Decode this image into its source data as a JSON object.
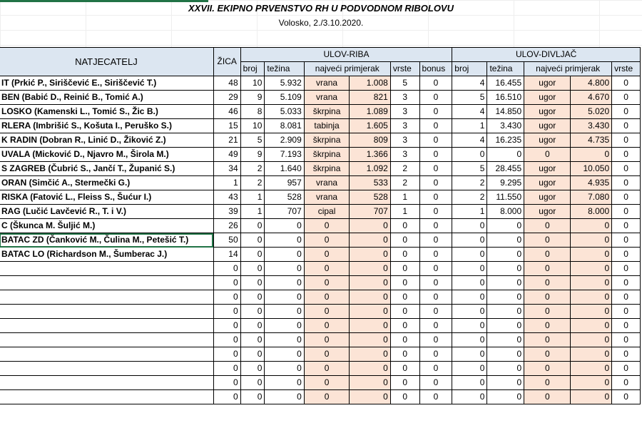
{
  "title": "XXVII. EKIPNO PRVENSTVO RH U PODVODNOM RIBOLOVU",
  "subtitle": "Volosko, 2./3.10.2020.",
  "headers": {
    "natjecatelj": "NATJECATELJ",
    "zica": "ŽICA",
    "ulov_riba": "ULOV-RIBA",
    "ulov_divljac": "ULOV-DIVLJAČ",
    "broj": "broj",
    "tezina": "težina",
    "najveci": "najveći primjerak",
    "vrste": "vrste",
    "bonus": "bonus"
  },
  "rows": [
    {
      "name": "IT (Prkić P., Siriščević E., Siriščević T.)",
      "zica": "48",
      "r_broj": "10",
      "r_tez": "5.932",
      "r_vrsta": "vrana",
      "r_naj": "1.008",
      "r_vrste": "5",
      "r_bonus": "0",
      "d_broj": "4",
      "d_tez": "16.455",
      "d_vrsta": "ugor",
      "d_naj": "4.800",
      "d_vrste": "0"
    },
    {
      "name": "BEN (Babić D., Reinić B., Tomić A.)",
      "zica": "29",
      "r_broj": "9",
      "r_tez": "5.109",
      "r_vrsta": "vrana",
      "r_naj": "821",
      "r_vrste": "3",
      "r_bonus": "0",
      "d_broj": "5",
      "d_tez": "16.510",
      "d_vrsta": "ugor",
      "d_naj": "4.670",
      "d_vrste": "0"
    },
    {
      "name": "LOSKO (Kamenski L., Tomić S., Žic B.)",
      "zica": "46",
      "r_broj": "8",
      "r_tez": "5.033",
      "r_vrsta": "škrpina",
      "r_naj": "1.089",
      "r_vrste": "3",
      "r_bonus": "0",
      "d_broj": "4",
      "d_tez": "14.850",
      "d_vrsta": "ugor",
      "d_naj": "5.020",
      "d_vrste": "0"
    },
    {
      "name": "RLERA (Imbrišić S., Košuta I., Peruško S.)",
      "zica": "15",
      "r_broj": "10",
      "r_tez": "8.081",
      "r_vrsta": "tabinja",
      "r_naj": "1.605",
      "r_vrste": "3",
      "r_bonus": "0",
      "d_broj": "1",
      "d_tez": "3.430",
      "d_vrsta": "ugor",
      "d_naj": "3.430",
      "d_vrste": "0"
    },
    {
      "name": "K RADIN (Dobran R., Linić D., Žiković Z.)",
      "zica": "21",
      "r_broj": "5",
      "r_tez": "2.909",
      "r_vrsta": "škrpina",
      "r_naj": "809",
      "r_vrste": "3",
      "r_bonus": "0",
      "d_broj": "4",
      "d_tez": "16.235",
      "d_vrsta": "ugor",
      "d_naj": "4.735",
      "d_vrste": "0"
    },
    {
      "name": "UVALA (Micković D., Njavro M., Širola M.)",
      "zica": "49",
      "r_broj": "9",
      "r_tez": "7.193",
      "r_vrsta": "škrpina",
      "r_naj": "1.366",
      "r_vrste": "3",
      "r_bonus": "0",
      "d_broj": "0",
      "d_tez": "0",
      "d_vrsta": "0",
      "d_naj": "0",
      "d_vrste": "0"
    },
    {
      "name": "S ZAGREB (Čubrić S., Jančí T., Županić S.)",
      "zica": "34",
      "r_broj": "2",
      "r_tez": "1.640",
      "r_vrsta": "škrpina",
      "r_naj": "1.092",
      "r_vrste": "2",
      "r_bonus": "0",
      "d_broj": "5",
      "d_tez": "28.455",
      "d_vrsta": "ugor",
      "d_naj": "10.050",
      "d_vrste": "0"
    },
    {
      "name": "ORAN (Simčić A., Stermečki G.)",
      "zica": "1",
      "r_broj": "2",
      "r_tez": "957",
      "r_vrsta": "vrana",
      "r_naj": "533",
      "r_vrste": "2",
      "r_bonus": "0",
      "d_broj": "2",
      "d_tez": "9.295",
      "d_vrsta": "ugor",
      "d_naj": "4.935",
      "d_vrste": "0"
    },
    {
      "name": "RISKA (Fatović L., Fleiss S., Šućur I.)",
      "zica": "43",
      "r_broj": "1",
      "r_tez": "528",
      "r_vrsta": "vrana",
      "r_naj": "528",
      "r_vrste": "1",
      "r_bonus": "0",
      "d_broj": "2",
      "d_tez": "11.550",
      "d_vrsta": "ugor",
      "d_naj": "7.080",
      "d_vrste": "0"
    },
    {
      "name": "RAG (Lučić Lavčević R., T. i V.)",
      "zica": "39",
      "r_broj": "1",
      "r_tez": "707",
      "r_vrsta": "cipal",
      "r_naj": "707",
      "r_vrste": "1",
      "r_bonus": "0",
      "d_broj": "1",
      "d_tez": "8.000",
      "d_vrsta": "ugor",
      "d_naj": "8.000",
      "d_vrste": "0"
    },
    {
      "name": "C (Škunca M. Šuljić M.)",
      "zica": "26",
      "r_broj": "0",
      "r_tez": "0",
      "r_vrsta": "0",
      "r_naj": "0",
      "r_vrste": "0",
      "r_bonus": "0",
      "d_broj": "0",
      "d_tez": "0",
      "d_vrsta": "0",
      "d_naj": "0",
      "d_vrste": "0"
    },
    {
      "name": "BATAC ZD (Čanković M., Čulina M., Petešić T.)",
      "zica": "50",
      "r_broj": "0",
      "r_tez": "0",
      "r_vrsta": "0",
      "r_naj": "0",
      "r_vrste": "0",
      "r_bonus": "0",
      "d_broj": "0",
      "d_tez": "0",
      "d_vrsta": "0",
      "d_naj": "0",
      "d_vrste": "0"
    },
    {
      "name": "BATAC LO (Richardson M., Šumberac J.)",
      "zica": "14",
      "r_broj": "0",
      "r_tez": "0",
      "r_vrsta": "0",
      "r_naj": "0",
      "r_vrste": "0",
      "r_bonus": "0",
      "d_broj": "0",
      "d_tez": "0",
      "d_vrsta": "0",
      "d_naj": "0",
      "d_vrste": "0"
    },
    {
      "name": "",
      "zica": "0",
      "r_broj": "0",
      "r_tez": "0",
      "r_vrsta": "0",
      "r_naj": "0",
      "r_vrste": "0",
      "r_bonus": "0",
      "d_broj": "0",
      "d_tez": "0",
      "d_vrsta": "0",
      "d_naj": "0",
      "d_vrste": "0"
    },
    {
      "name": "",
      "zica": "0",
      "r_broj": "0",
      "r_tez": "0",
      "r_vrsta": "0",
      "r_naj": "0",
      "r_vrste": "0",
      "r_bonus": "0",
      "d_broj": "0",
      "d_tez": "0",
      "d_vrsta": "0",
      "d_naj": "0",
      "d_vrste": "0"
    },
    {
      "name": "",
      "zica": "0",
      "r_broj": "0",
      "r_tez": "0",
      "r_vrsta": "0",
      "r_naj": "0",
      "r_vrste": "0",
      "r_bonus": "0",
      "d_broj": "0",
      "d_tez": "0",
      "d_vrsta": "0",
      "d_naj": "0",
      "d_vrste": "0"
    },
    {
      "name": "",
      "zica": "0",
      "r_broj": "0",
      "r_tez": "0",
      "r_vrsta": "0",
      "r_naj": "0",
      "r_vrste": "0",
      "r_bonus": "0",
      "d_broj": "0",
      "d_tez": "0",
      "d_vrsta": "0",
      "d_naj": "0",
      "d_vrste": "0"
    },
    {
      "name": "",
      "zica": "0",
      "r_broj": "0",
      "r_tez": "0",
      "r_vrsta": "0",
      "r_naj": "0",
      "r_vrste": "0",
      "r_bonus": "0",
      "d_broj": "0",
      "d_tez": "0",
      "d_vrsta": "0",
      "d_naj": "0",
      "d_vrste": "0"
    },
    {
      "name": "",
      "zica": "0",
      "r_broj": "0",
      "r_tez": "0",
      "r_vrsta": "0",
      "r_naj": "0",
      "r_vrste": "0",
      "r_bonus": "0",
      "d_broj": "0",
      "d_tez": "0",
      "d_vrsta": "0",
      "d_naj": "0",
      "d_vrste": "0"
    },
    {
      "name": "",
      "zica": "0",
      "r_broj": "0",
      "r_tez": "0",
      "r_vrsta": "0",
      "r_naj": "0",
      "r_vrste": "0",
      "r_bonus": "0",
      "d_broj": "0",
      "d_tez": "0",
      "d_vrsta": "0",
      "d_naj": "0",
      "d_vrste": "0"
    },
    {
      "name": "",
      "zica": "0",
      "r_broj": "0",
      "r_tez": "0",
      "r_vrsta": "0",
      "r_naj": "0",
      "r_vrste": "0",
      "r_bonus": "0",
      "d_broj": "0",
      "d_tez": "0",
      "d_vrsta": "0",
      "d_naj": "0",
      "d_vrste": "0"
    },
    {
      "name": "",
      "zica": "0",
      "r_broj": "0",
      "r_tez": "0",
      "r_vrsta": "0",
      "r_naj": "0",
      "r_vrste": "0",
      "r_bonus": "0",
      "d_broj": "0",
      "d_tez": "0",
      "d_vrsta": "0",
      "d_naj": "0",
      "d_vrste": "0"
    },
    {
      "name": "",
      "zica": "0",
      "r_broj": "0",
      "r_tez": "0",
      "r_vrsta": "0",
      "r_naj": "0",
      "r_vrste": "0",
      "r_bonus": "0",
      "d_broj": "0",
      "d_tez": "0",
      "d_vrsta": "0",
      "d_naj": "0",
      "d_vrste": "0"
    }
  ],
  "colors": {
    "header_bg": "#dce6f1",
    "peach_bg": "#fce4d6",
    "excel_green": "#217346"
  }
}
